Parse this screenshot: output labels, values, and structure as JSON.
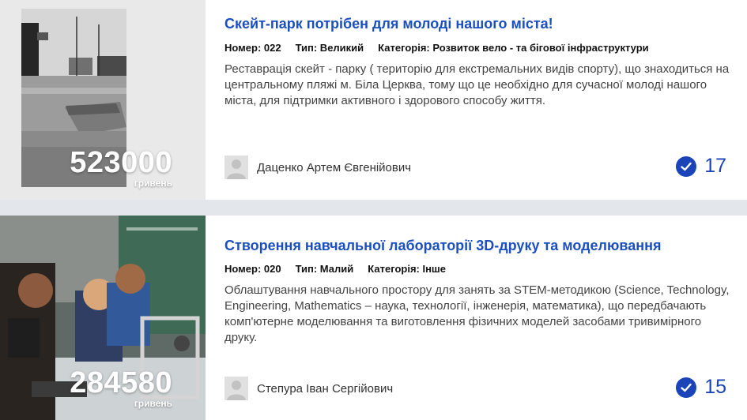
{
  "projects": [
    {
      "title": "Скейт-парк потрібен для молоді нашого міста!",
      "number_label": "Номер: 022",
      "type_label": "Тип: Великий",
      "category_label": "Категорія: Розвиток вело - та бігової інфраструктури",
      "description": "Реставрація скейт - парку ( територію для екстремальних видів спорту), що знаходиться на центральному пляжі м. Біла Церква, тому що це необхідно для сучасної молоді нашого міста, для підтримки активного і здорового способу життя.",
      "amount": "523000",
      "currency": "гривень",
      "author": "Даценко Артем Євгенійович",
      "votes": "17"
    },
    {
      "title": "Створення навчальної лабораторії 3D-друку та моделювання",
      "number_label": "Номер: 020",
      "type_label": "Тип: Малий",
      "category_label": "Категорія: Інше",
      "description": "Облаштування навчального простору для занять за STEM-методикою (Science, Technology, Engineering, Mathematics – наука, технології, інженерія, математика), що передбачають комп'ютерне моделювання та виготовлення фізичних моделей засобами тривимірного друку.",
      "amount": "284580",
      "currency": "гривень",
      "author": "Степура Іван Сергійович",
      "votes": "15"
    }
  ],
  "colors": {
    "title": "#1a4fbf",
    "vote": "#1a44b8"
  },
  "icons": {
    "vote": "check-circle-icon",
    "avatar": "user-avatar-icon"
  }
}
